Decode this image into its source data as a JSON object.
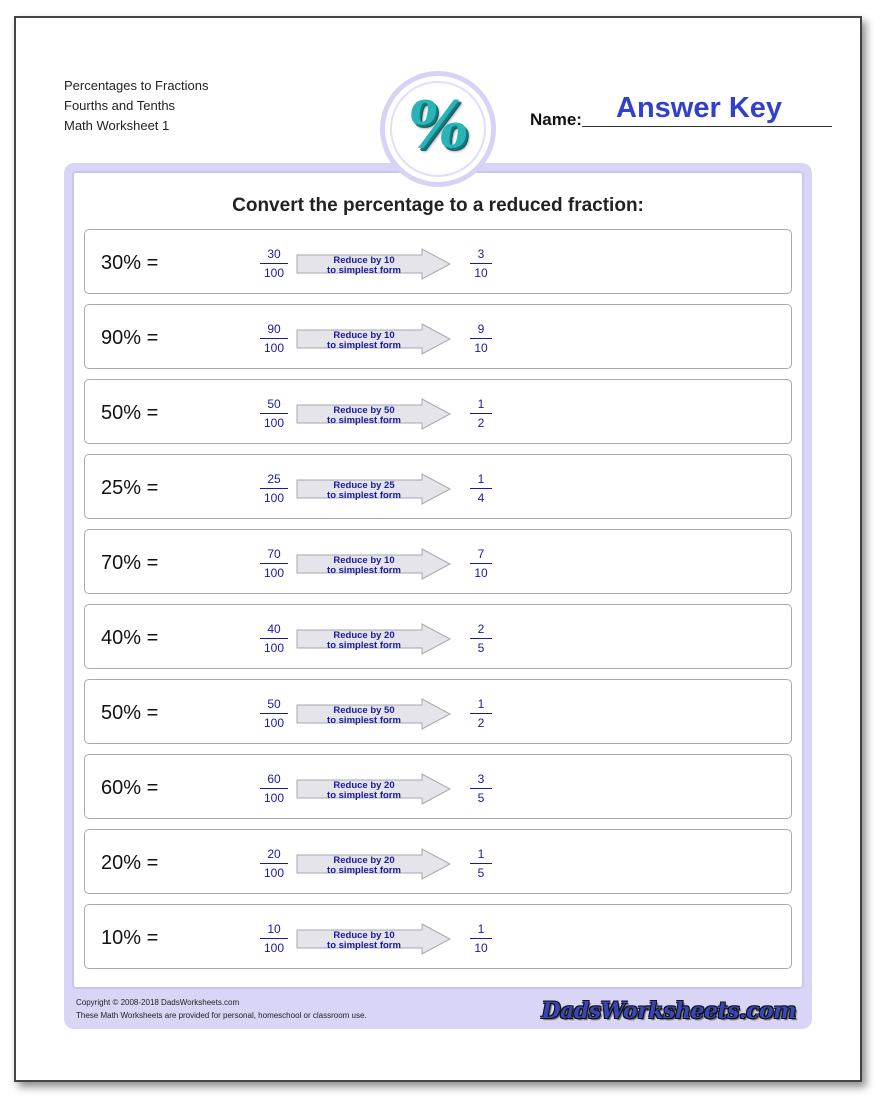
{
  "header": {
    "title_lines": [
      "Percentages to Fractions",
      "Fourths and Tenths",
      "Math Worksheet 1"
    ],
    "name_label": "Name:",
    "name_value": "Answer Key",
    "logo_icon": "percent-icon"
  },
  "instructions": "Convert the percentage to a reduced fraction:",
  "problems": [
    {
      "percent": "30% =",
      "num": "30",
      "den": "100",
      "reduce_line1": "Reduce by 10",
      "reduce_line2": "to simplest form",
      "ans_num": "3",
      "ans_den": "10"
    },
    {
      "percent": "90% =",
      "num": "90",
      "den": "100",
      "reduce_line1": "Reduce by 10",
      "reduce_line2": "to simplest form",
      "ans_num": "9",
      "ans_den": "10"
    },
    {
      "percent": "50% =",
      "num": "50",
      "den": "100",
      "reduce_line1": "Reduce by 50",
      "reduce_line2": "to simplest form",
      "ans_num": "1",
      "ans_den": "2"
    },
    {
      "percent": "25% =",
      "num": "25",
      "den": "100",
      "reduce_line1": "Reduce by 25",
      "reduce_line2": "to simplest form",
      "ans_num": "1",
      "ans_den": "4"
    },
    {
      "percent": "70% =",
      "num": "70",
      "den": "100",
      "reduce_line1": "Reduce by 10",
      "reduce_line2": "to simplest form",
      "ans_num": "7",
      "ans_den": "10"
    },
    {
      "percent": "40% =",
      "num": "40",
      "den": "100",
      "reduce_line1": "Reduce by 20",
      "reduce_line2": "to simplest form",
      "ans_num": "2",
      "ans_den": "5"
    },
    {
      "percent": "50% =",
      "num": "50",
      "den": "100",
      "reduce_line1": "Reduce by 50",
      "reduce_line2": "to simplest form",
      "ans_num": "1",
      "ans_den": "2"
    },
    {
      "percent": "60% =",
      "num": "60",
      "den": "100",
      "reduce_line1": "Reduce by 20",
      "reduce_line2": "to simplest form",
      "ans_num": "3",
      "ans_den": "5"
    },
    {
      "percent": "20% =",
      "num": "20",
      "den": "100",
      "reduce_line1": "Reduce by 20",
      "reduce_line2": "to simplest form",
      "ans_num": "1",
      "ans_den": "5"
    },
    {
      "percent": "10% =",
      "num": "10",
      "den": "100",
      "reduce_line1": "Reduce by 10",
      "reduce_line2": "to simplest form",
      "ans_num": "1",
      "ans_den": "10"
    }
  ],
  "footer": {
    "copyright": "Copyright © 2008-2018 DadsWorksheets.com",
    "usage": "These Math Worksheets are provided for personal, homeschool or classroom use.",
    "logo_text": "DadsWorksheets.com"
  },
  "colors": {
    "answer": "#3341c9",
    "fraction_text": "#1a1aa0",
    "frame": "#d8d5f7",
    "percent_logo": "#2bb4b8"
  }
}
